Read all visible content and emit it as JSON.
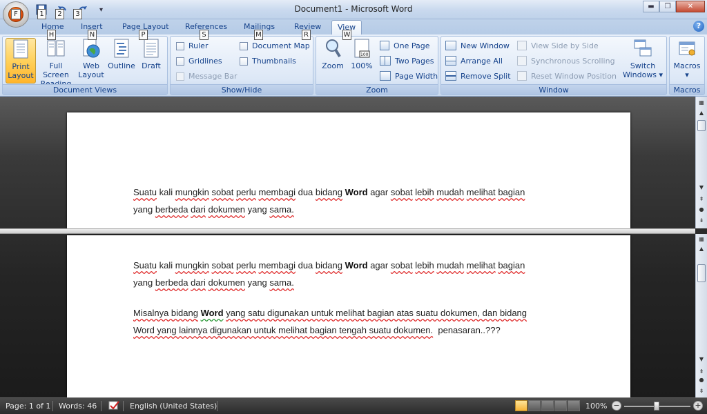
{
  "window": {
    "title": "Document1 - Microsoft Word",
    "close_label": "✕",
    "max_label": "❐",
    "min_label": "▬"
  },
  "office_button": {
    "keytip": "F"
  },
  "qat": {
    "keytips": [
      "1",
      "2",
      "3"
    ],
    "customize_arrow": "▾"
  },
  "tabs": [
    {
      "label": "Home",
      "keytip": "H"
    },
    {
      "label": "Insert",
      "keytip": "N"
    },
    {
      "label": "Page Layout",
      "keytip": "P"
    },
    {
      "label": "References",
      "keytip": "S"
    },
    {
      "label": "Mailings",
      "keytip": "M"
    },
    {
      "label": "Review",
      "keytip": "R"
    },
    {
      "label": "View",
      "keytip": "W"
    }
  ],
  "help": {
    "label": "?"
  },
  "ribbon": {
    "document_views": {
      "label": "Document Views",
      "buttons": [
        {
          "line1": "Print",
          "line2": "Layout"
        },
        {
          "line1": "Full Screen",
          "line2": "Reading"
        },
        {
          "line1": "Web",
          "line2": "Layout"
        },
        {
          "line1": "Outline",
          "line2": ""
        },
        {
          "line1": "Draft",
          "line2": ""
        }
      ]
    },
    "show_hide": {
      "label": "Show/Hide",
      "ruler": "Ruler",
      "gridlines": "Gridlines",
      "message_bar": "Message Bar",
      "document_map": "Document Map",
      "thumbnails": "Thumbnails"
    },
    "zoom": {
      "label": "Zoom",
      "zoom_button": "Zoom",
      "percent_button": "100%",
      "percent_icon_text": "100",
      "one_page": "One Page",
      "two_pages": "Two Pages",
      "page_width": "Page Width"
    },
    "window": {
      "label": "Window",
      "new_window": "New Window",
      "arrange_all": "Arrange All",
      "remove_split": "Remove Split",
      "view_side_by_side": "View Side by Side",
      "synchronous_scrolling": "Synchronous Scrolling",
      "reset_window_position": "Reset Window Position",
      "switch_windows_line1": "Switch",
      "switch_windows_line2": "Windows ▾"
    },
    "macros": {
      "label": "Macros",
      "button": "Macros",
      "arrow": "▾"
    }
  },
  "document": {
    "top_pane": {
      "p1_words": [
        "Suatu",
        "kali",
        "mungkin",
        "sobat",
        "perlu",
        "membagi",
        "dua",
        "bidang",
        "Word",
        "agar",
        "sobat",
        "lebih",
        "mudah",
        "melihat",
        "bagian"
      ],
      "p1_line2": [
        "yang",
        "berbeda",
        "dari",
        "dokumen",
        "yang",
        "sama."
      ]
    },
    "bottom_pane": {
      "p1_line1": [
        "Suatu",
        "kali",
        "mungkin",
        "sobat",
        "perlu",
        "membagi",
        "dua",
        "bidang",
        "Word",
        "agar",
        "sobat",
        "lebih",
        "mudah",
        "melihat",
        "bagian"
      ],
      "p1_line2": [
        "yang",
        "berbeda",
        "dari",
        "dokumen",
        "yang",
        "sama."
      ],
      "p2_line1_a": "Misalnya bidang",
      "p2_line1_b": "Word",
      "p2_line1_c": "yang satu digunakan untuk melihat bagian atas suatu dokumen, dan bidang",
      "p2_line2_a": "Word yang lainnya digunakan untuk melihat bagian tengah suatu dokumen.",
      "p2_line2_b": "penasaran..???"
    }
  },
  "status": {
    "page": "Page: 1 of 1",
    "words": "Words: 46",
    "language": "English (United States)",
    "zoom": "100%",
    "zoom_minus": "−",
    "zoom_plus": "+"
  },
  "colors": {
    "ribbon_blue": "#15428b",
    "spell_error": "#e03030",
    "grammar_error": "#2e9a3a",
    "active_view": "#ffd15c"
  }
}
